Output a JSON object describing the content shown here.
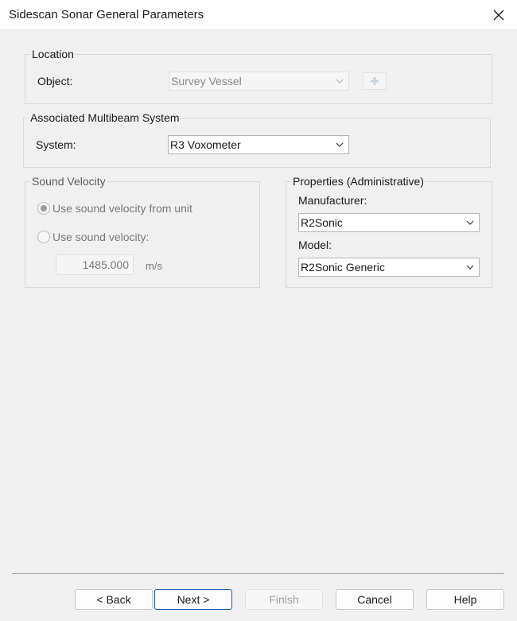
{
  "window": {
    "title": "Sidescan Sonar General Parameters"
  },
  "location": {
    "group_label": "Location",
    "object_label": "Object:",
    "object_value": "Survey Vessel",
    "add_icon": "plus-icon"
  },
  "multibeam": {
    "group_label": "Associated Multibeam System",
    "system_label": "System:",
    "system_value": "R3 Voxometer"
  },
  "sound_velocity": {
    "group_label": "Sound Velocity",
    "option_from_unit": "Use sound velocity from unit",
    "option_manual": "Use sound velocity:",
    "selected": "from_unit",
    "value": "1485.000",
    "unit": "m/s"
  },
  "properties": {
    "group_label": "Properties (Administrative)",
    "manufacturer_label": "Manufacturer:",
    "manufacturer_value": "R2Sonic",
    "model_label": "Model:",
    "model_value": "R2Sonic Generic"
  },
  "buttons": {
    "back": "< Back",
    "next": "Next >",
    "finish": "Finish",
    "cancel": "Cancel",
    "help": "Help"
  },
  "colors": {
    "default_button_border": "#1b5fa8",
    "background": "#f0f0f0"
  }
}
